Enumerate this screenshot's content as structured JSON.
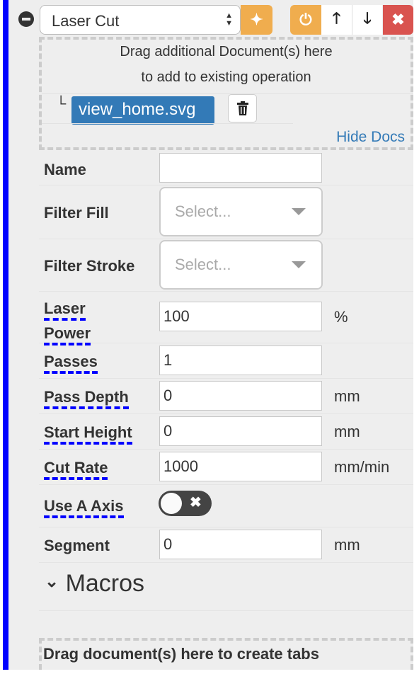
{
  "operation": {
    "type": "Laser Cut"
  },
  "docs": {
    "drag_line1": "Drag additional Document(s) here",
    "drag_line2": "to add to existing operation",
    "tree_glyph": "└",
    "items": [
      {
        "name": "view_home.svg"
      }
    ],
    "hide_label": "Hide Docs"
  },
  "fields": {
    "name": {
      "label": "Name",
      "value": ""
    },
    "filter_fill": {
      "label": "Filter Fill",
      "placeholder": "Select..."
    },
    "filter_stroke": {
      "label": "Filter Stroke",
      "placeholder": "Select..."
    },
    "laser_power": {
      "label1": "Laser",
      "label2": "Power",
      "value": "100",
      "unit": "%"
    },
    "passes": {
      "label": "Passes",
      "value": "1"
    },
    "pass_depth": {
      "label": "Pass Depth",
      "value": "0",
      "unit": "mm"
    },
    "start_height": {
      "label": "Start Height",
      "value": "0",
      "unit": "mm"
    },
    "cut_rate": {
      "label": "Cut Rate",
      "value": "1000",
      "unit": "mm/min"
    },
    "use_a_axis": {
      "label": "Use A Axis",
      "enabled": false
    },
    "segment": {
      "label": "Segment",
      "value": "0",
      "unit": "mm"
    }
  },
  "macros": {
    "label": "Macros"
  },
  "dropzone": {
    "label": "Drag document(s) here to create tabs"
  },
  "colors": {
    "accent_blue": "#0000ff",
    "warning": "#f0ad4e",
    "danger": "#d9534f",
    "primary": "#337ab7"
  }
}
